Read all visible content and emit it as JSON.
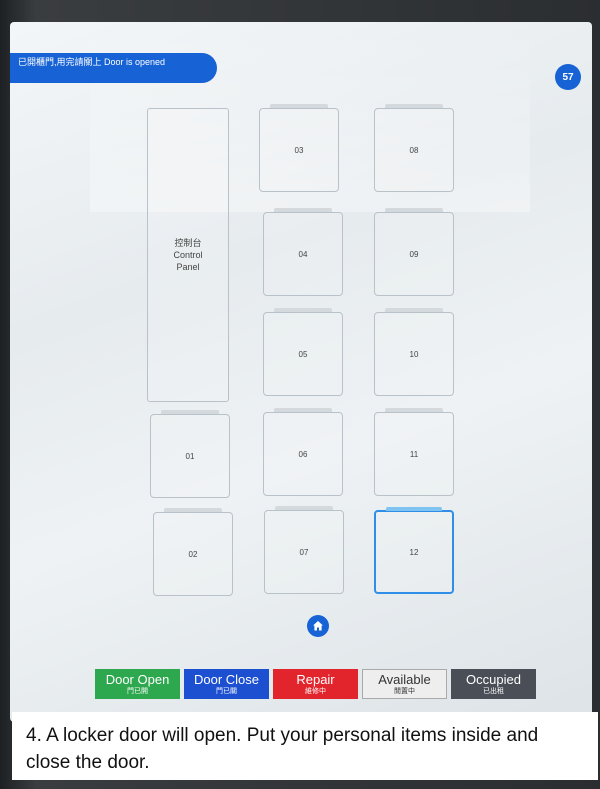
{
  "banner": {
    "text": "已開櫃門,用完請關上 Door is opened"
  },
  "count_badge": "57",
  "control_panel": {
    "zh": "控制台",
    "en_line1": "Control",
    "en_line2": "Panel"
  },
  "lockers": [
    {
      "id": "03"
    },
    {
      "id": "08"
    },
    {
      "id": "04"
    },
    {
      "id": "09"
    },
    {
      "id": "05"
    },
    {
      "id": "10"
    },
    {
      "id": "01"
    },
    {
      "id": "06"
    },
    {
      "id": "11"
    },
    {
      "id": "02"
    },
    {
      "id": "07"
    },
    {
      "id": "12"
    }
  ],
  "selected_locker": "12",
  "home_icon": "home-icon",
  "legend": [
    {
      "en": "Door Open",
      "zh": "門已開",
      "color": "#2ea84f"
    },
    {
      "en": "Door Close",
      "zh": "門已關",
      "color": "#1d4fd1"
    },
    {
      "en": "Repair",
      "zh": "維修中",
      "color": "#e2242c"
    },
    {
      "en": "Available",
      "zh": "閒置中",
      "color": "#eeeeee"
    },
    {
      "en": "Occupied",
      "zh": "已出租",
      "color": "#4a4f57"
    }
  ],
  "caption": "4. A locker door will open. Put your personal items inside and close the door."
}
